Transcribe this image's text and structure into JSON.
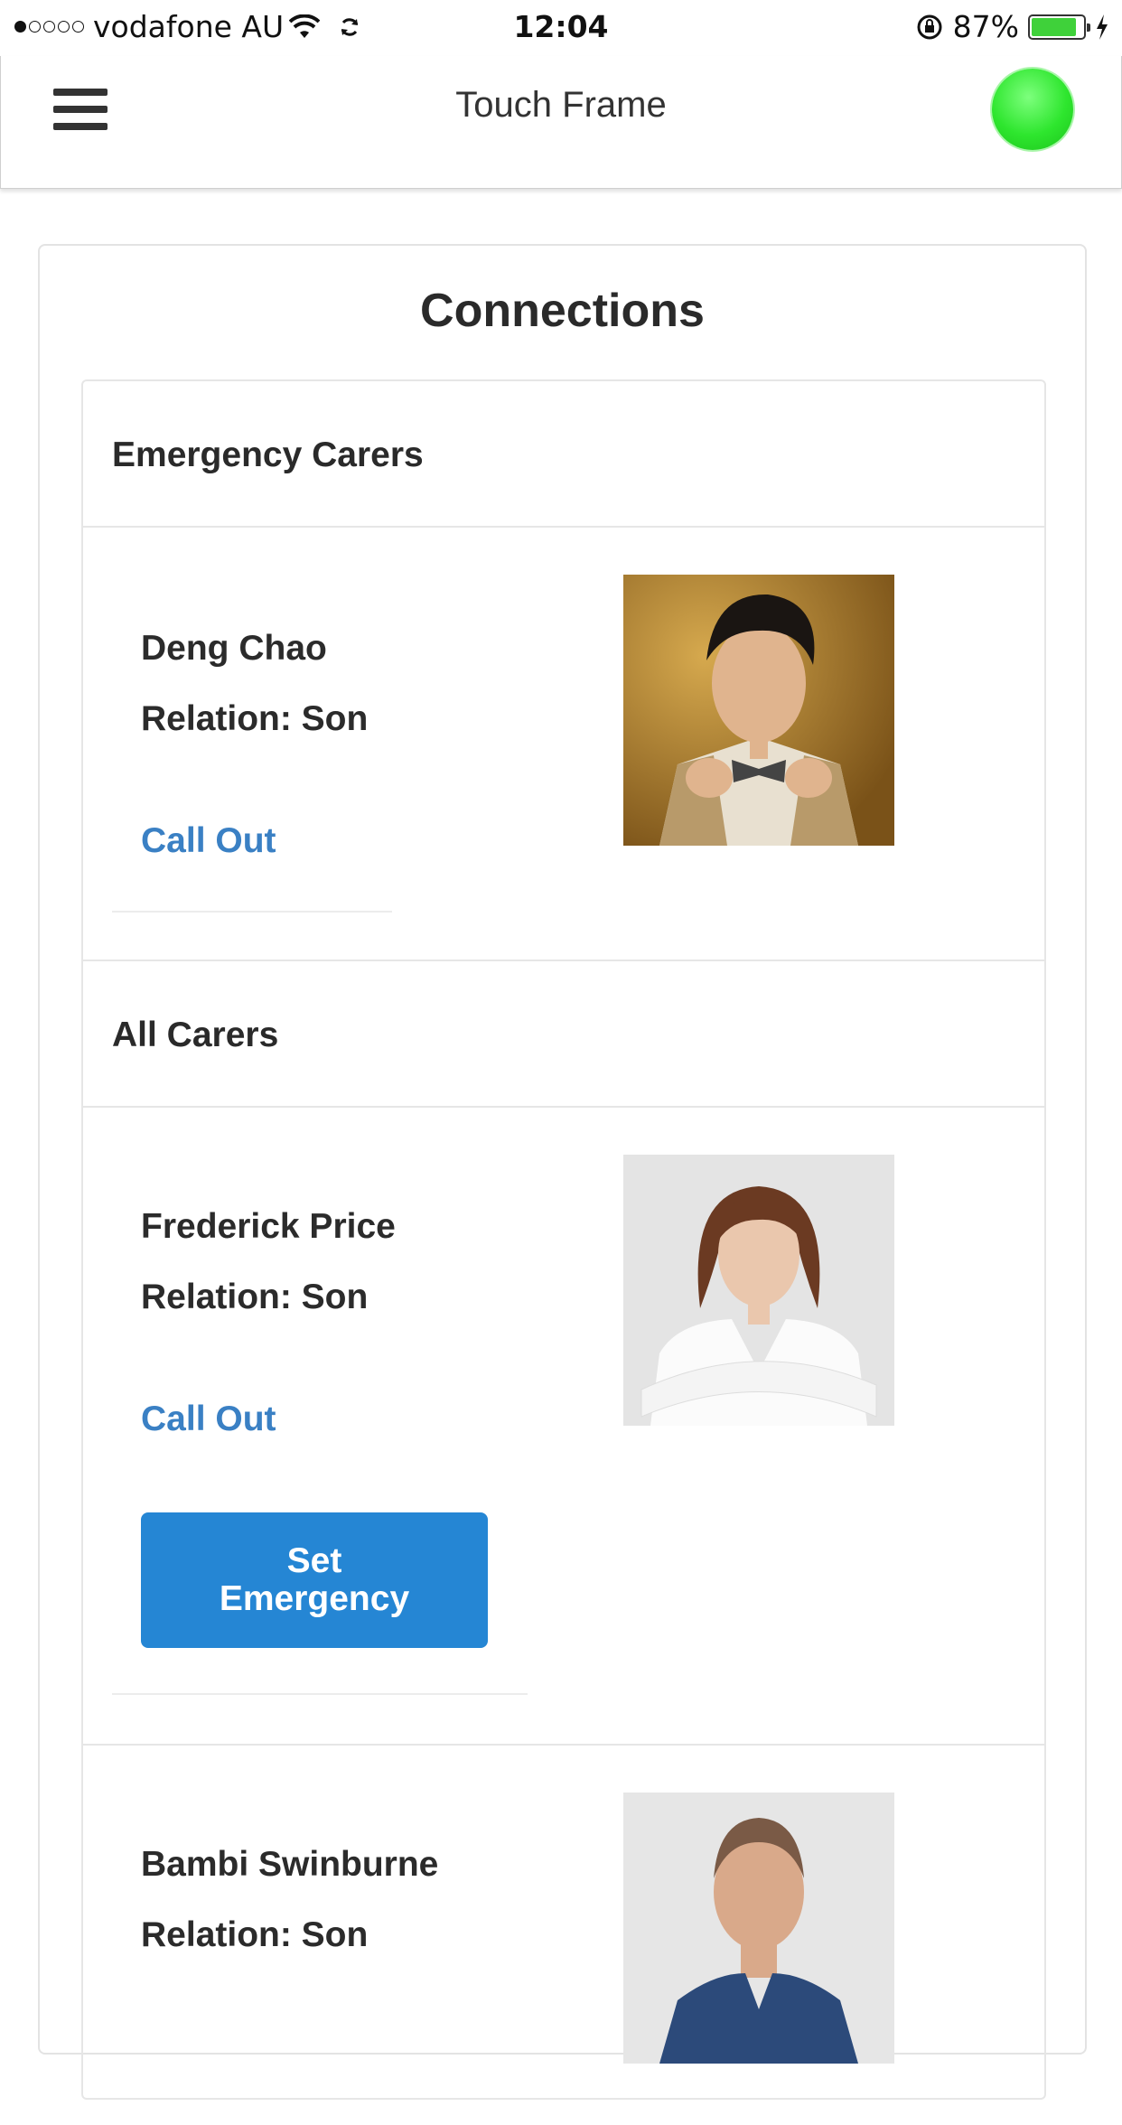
{
  "status_bar": {
    "carrier": "vodafone AU",
    "time": "12:04",
    "battery": "87%",
    "battery_level": 0.87
  },
  "header": {
    "title": "Touch Frame",
    "menu_icon": "hamburger-menu-icon",
    "status_indicator_color": "#2ee62e"
  },
  "connections": {
    "title": "Connections",
    "emergency_section": {
      "heading": "Emergency Carers",
      "carers": [
        {
          "name": "Deng Chao",
          "relation": "Relation: Son",
          "call_label": "Call Out"
        }
      ]
    },
    "all_section": {
      "heading": "All Carers",
      "carers": [
        {
          "name": "Frederick Price",
          "relation": "Relation: Son",
          "call_label": "Call Out",
          "button_label": "Set Emergency"
        },
        {
          "name": "Bambi Swinburne",
          "relation": "Relation: Son"
        }
      ]
    }
  },
  "colors": {
    "accent": "#2586d4",
    "link": "#3a80c4"
  }
}
